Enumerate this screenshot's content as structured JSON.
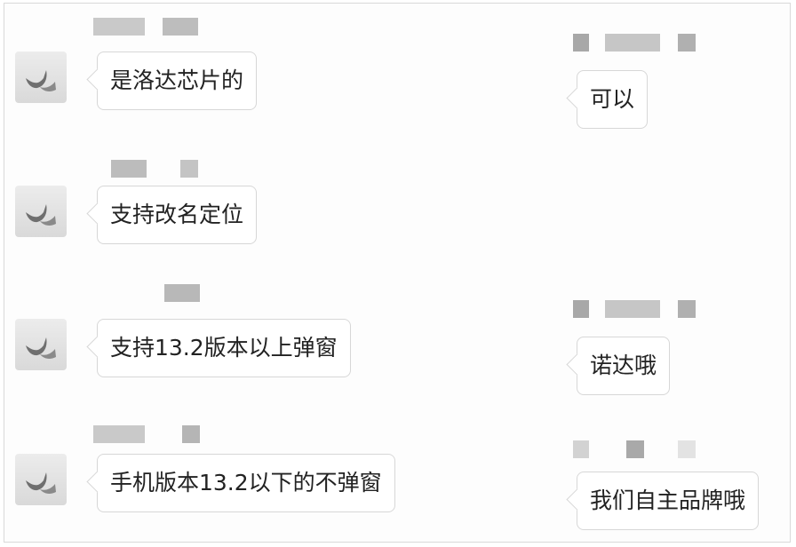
{
  "messages": [
    {
      "text": "是洛达芯片的"
    },
    {
      "text": "可以"
    },
    {
      "text": "支持改名定位"
    },
    {
      "text": "支持13.2版本以上弹窗"
    },
    {
      "text": "诺达哦"
    },
    {
      "text": "手机版本13.2以下的不弹窗"
    },
    {
      "text": "我们自主品牌哦"
    }
  ],
  "colors": {
    "bubble_border": "#d7d7d7",
    "bubble_background": "#ffffff",
    "text": "#222222",
    "blur": "#b4b4b4"
  },
  "icons": {
    "avatar": "white-shoes-avatar-icon"
  }
}
